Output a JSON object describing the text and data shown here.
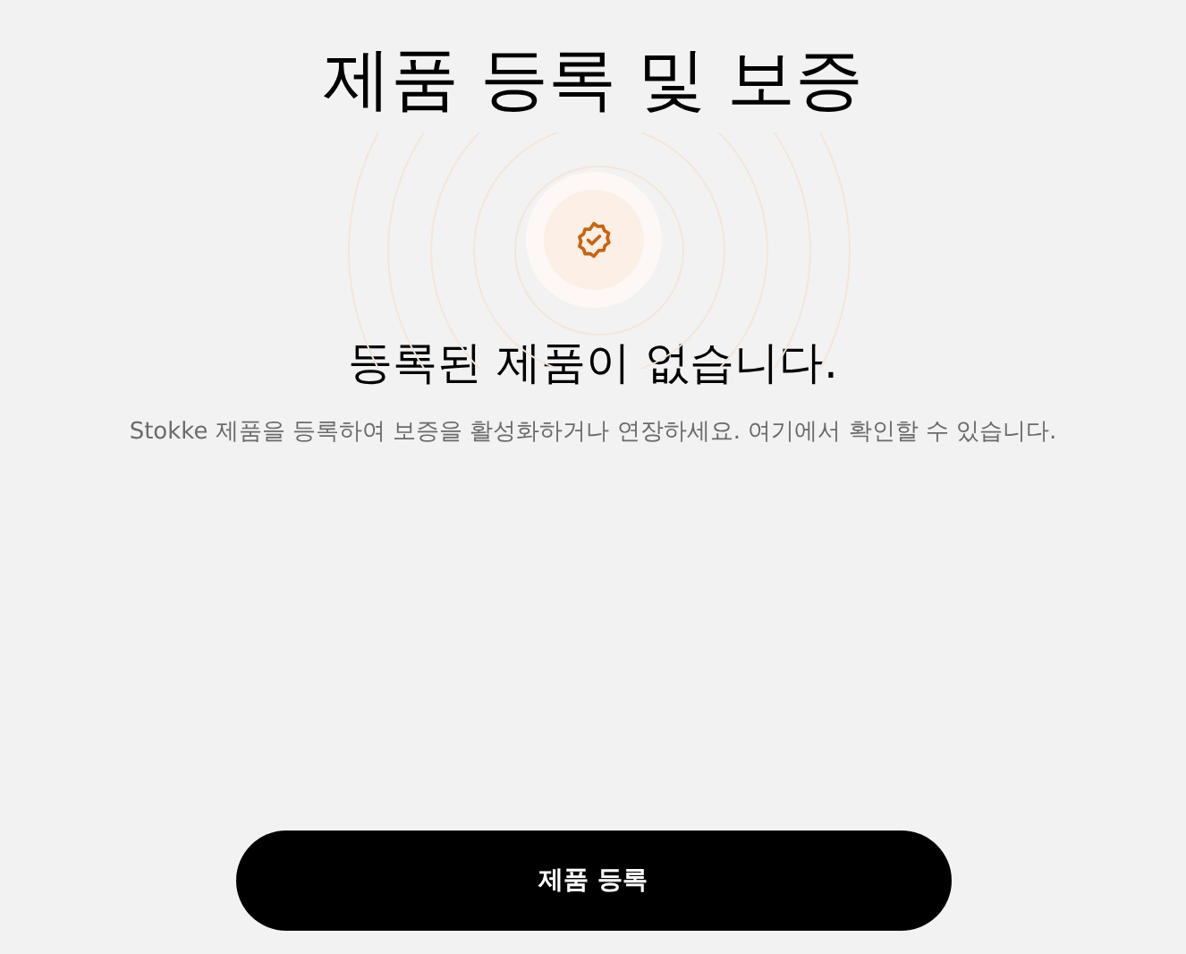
{
  "title": "제품 등록 및 보증",
  "empty_state": {
    "heading": "등록된 제품이 없습니다.",
    "description": "Stokke 제품을 등록하여 보증을 활성화하거나 연장하세요. 여기에서 확인할 수 있습니다."
  },
  "button": {
    "label": "제품 등록"
  }
}
